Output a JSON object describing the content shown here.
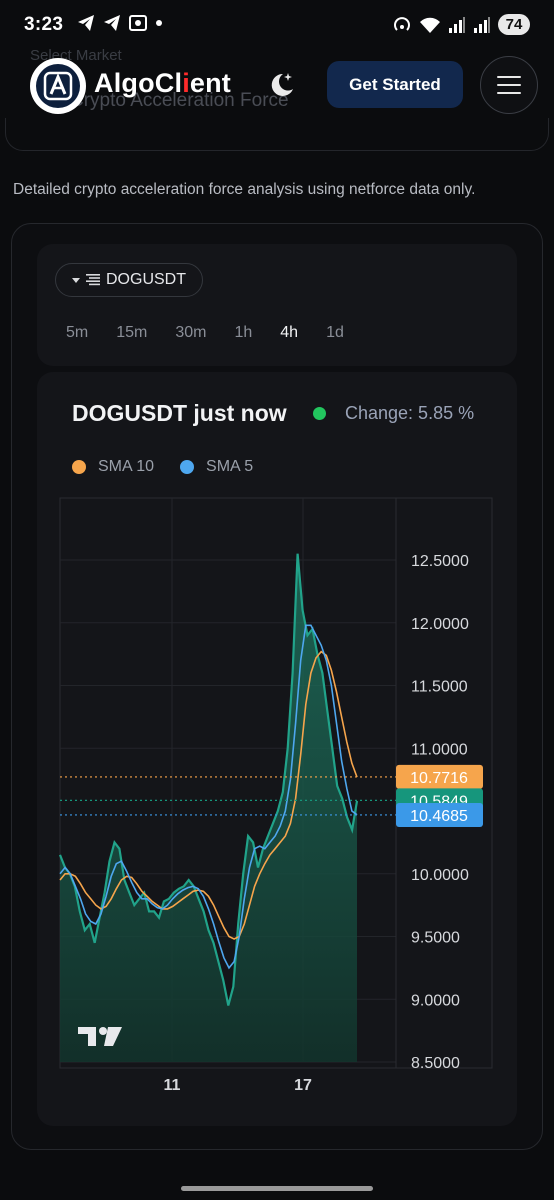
{
  "status_bar": {
    "time": "3:23",
    "battery": "74"
  },
  "navbar": {
    "ghost_market_label": "Select Market",
    "ghost_title": "Crypto Acceleration Force",
    "brand_prefix": "AlgoCl",
    "brand_accent": "i",
    "brand_suffix": "ent",
    "get_started_label": "Get Started"
  },
  "description": "Detailed crypto acceleration force analysis using netforce data only.",
  "selector": {
    "symbol": "DOGUSDT",
    "timeframes": [
      "5m",
      "15m",
      "30m",
      "1h",
      "4h",
      "1d"
    ],
    "active_timeframe": "4h"
  },
  "chart_header": {
    "title": "DOGUSDT just now",
    "change_label": "Change: 5.85 %",
    "legend": [
      {
        "label": "SMA 10",
        "color": "#f6a54c"
      },
      {
        "label": "SMA 5",
        "color": "#4ea7ef"
      }
    ]
  },
  "chart_data": {
    "type": "area",
    "x_ticks": [
      "11",
      "17"
    ],
    "y_ticks": [
      "12.5000",
      "12.0000",
      "11.5000",
      "11.0000",
      "10.0000",
      "9.5000",
      "9.0000",
      "8.5000"
    ],
    "ylim": [
      8.5,
      12.5
    ],
    "grid": true,
    "series": [
      {
        "name": "",
        "color": "#21a38a",
        "values": [
          10.15,
          10.05,
          10.0,
          9.9,
          9.7,
          9.55,
          9.6,
          9.45,
          9.65,
          9.85,
          10.1,
          10.25,
          10.2,
          9.95,
          9.85,
          9.75,
          9.8,
          9.85,
          9.7,
          9.7,
          9.65,
          9.78,
          9.8,
          9.85,
          9.88,
          9.9,
          9.95,
          9.9,
          9.8,
          9.7,
          9.55,
          9.45,
          9.3,
          9.15,
          8.95,
          9.1,
          9.6,
          10.0,
          10.3,
          10.25,
          10.05,
          10.2,
          10.3,
          10.4,
          10.5,
          10.65,
          11.0,
          11.6,
          12.55,
          12.1,
          11.9,
          11.95,
          11.75,
          11.6,
          11.3,
          11.0,
          10.7,
          10.6,
          10.45,
          10.35,
          10.58
        ]
      },
      {
        "name": "SMA 10",
        "color": "#f6a54c",
        "values": [
          9.95,
          10.0,
          10.0,
          9.98,
          9.92,
          9.85,
          9.8,
          9.75,
          9.72,
          9.74,
          9.8,
          9.88,
          9.95,
          9.98,
          9.97,
          9.92,
          9.86,
          9.82,
          9.78,
          9.75,
          9.72,
          9.72,
          9.74,
          9.77,
          9.8,
          9.83,
          9.86,
          9.87,
          9.86,
          9.82,
          9.75,
          9.66,
          9.57,
          9.5,
          9.48,
          9.5,
          9.6,
          9.75,
          9.9,
          10.0,
          10.08,
          10.15,
          10.2,
          10.25,
          10.3,
          10.4,
          10.6,
          10.95,
          11.35,
          11.6,
          11.72,
          11.77,
          11.74,
          11.62,
          11.45,
          11.25,
          11.05,
          10.88,
          10.77
        ]
      },
      {
        "name": "SMA 5",
        "color": "#4ea7ef",
        "values": [
          10.0,
          10.05,
          10.0,
          9.9,
          9.8,
          9.68,
          9.62,
          9.6,
          9.68,
          9.82,
          9.98,
          10.08,
          10.1,
          10.02,
          9.93,
          9.85,
          9.8,
          9.8,
          9.76,
          9.73,
          9.72,
          9.75,
          9.8,
          9.84,
          9.87,
          9.89,
          9.9,
          9.88,
          9.82,
          9.72,
          9.6,
          9.46,
          9.33,
          9.25,
          9.3,
          9.5,
          9.8,
          10.05,
          10.2,
          10.22,
          10.2,
          10.25,
          10.3,
          10.38,
          10.5,
          10.75,
          11.2,
          11.7,
          11.98,
          11.98,
          11.9,
          11.82,
          11.7,
          11.5,
          11.2,
          10.9,
          10.68,
          10.5,
          10.47
        ]
      }
    ],
    "price_tags": [
      {
        "label": "10.7716",
        "value": 10.7716,
        "color": "#f6a54c"
      },
      {
        "label": "10.5849",
        "value": 10.5849,
        "color": "#16967c"
      },
      {
        "label": "10.4685",
        "value": 10.4685,
        "color": "#3b99e8"
      }
    ]
  },
  "colors": {
    "background": "#0b0c0e",
    "card": "#141519",
    "accent_button": "#12284d",
    "positive": "#22c55e"
  }
}
